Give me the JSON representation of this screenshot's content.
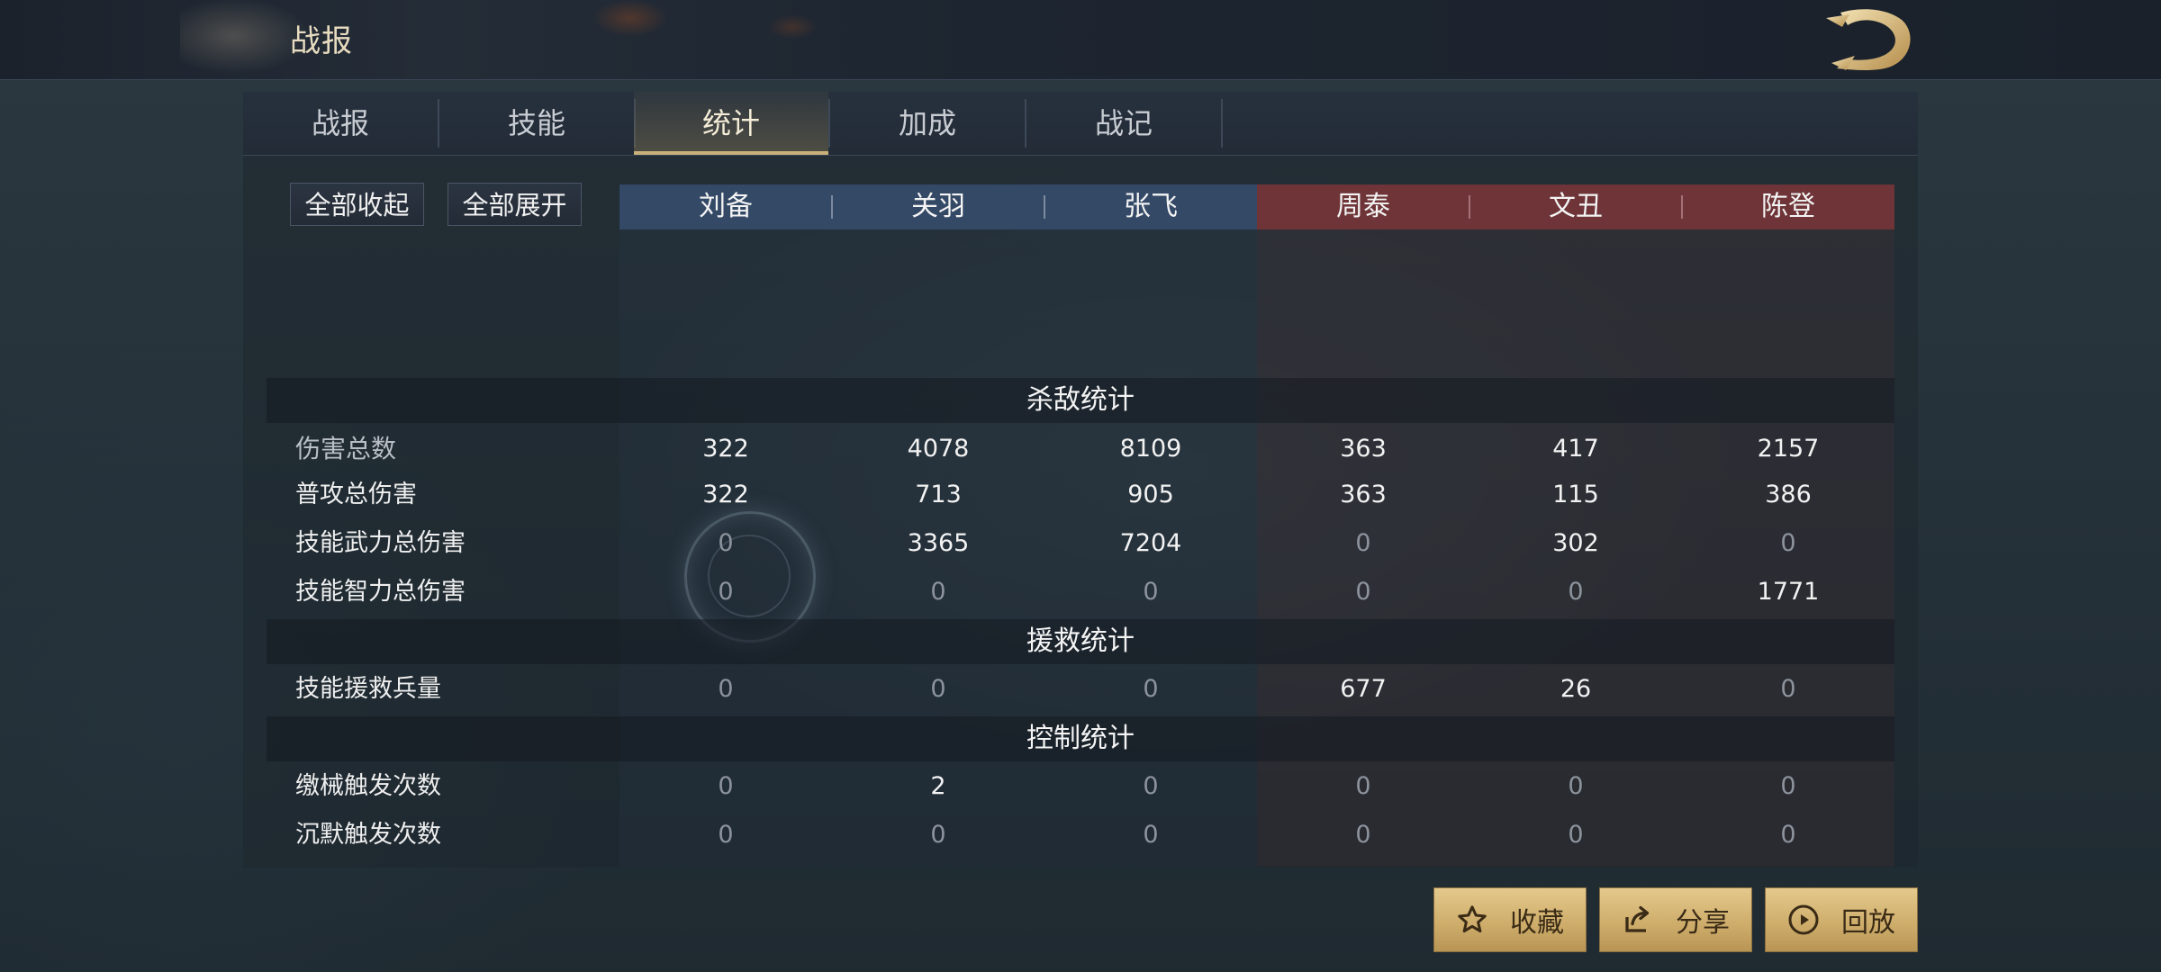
{
  "header": {
    "title": "战报"
  },
  "tabs": [
    {
      "label": "战报",
      "active": false
    },
    {
      "label": "技能",
      "active": false
    },
    {
      "label": "统计",
      "active": true
    },
    {
      "label": "加成",
      "active": false
    },
    {
      "label": "战记",
      "active": false
    }
  ],
  "controls": {
    "collapse_all": "全部收起",
    "expand_all": "全部展开"
  },
  "team_colors": {
    "ally": "#344966",
    "enemy": "#6e3438",
    "accent": "#c8b07a"
  },
  "heroes": {
    "ally": [
      "刘备",
      "关羽",
      "张飞"
    ],
    "enemy": [
      "周泰",
      "文丑",
      "陈登"
    ]
  },
  "sections": {
    "kill": {
      "title": "杀敌统计",
      "rows": [
        {
          "label": "伤害总数",
          "values": [
            "322",
            "4078",
            "8109",
            "363",
            "417",
            "2157"
          ]
        },
        {
          "label": "普攻总伤害",
          "values": [
            "322",
            "713",
            "905",
            "363",
            "115",
            "386"
          ]
        },
        {
          "label": "技能武力总伤害",
          "values": [
            "0",
            "3365",
            "7204",
            "0",
            "302",
            "0"
          ]
        },
        {
          "label": "技能智力总伤害",
          "values": [
            "0",
            "0",
            "0",
            "0",
            "0",
            "1771"
          ]
        }
      ]
    },
    "rescue": {
      "title": "援救统计",
      "rows": [
        {
          "label": "技能援救兵量",
          "values": [
            "0",
            "0",
            "0",
            "677",
            "26",
            "0"
          ]
        }
      ]
    },
    "control": {
      "title": "控制统计",
      "rows": [
        {
          "label": "缴械触发次数",
          "values": [
            "0",
            "2",
            "0",
            "0",
            "0",
            "0"
          ]
        },
        {
          "label": "沉默触发次数",
          "values": [
            "0",
            "0",
            "0",
            "0",
            "0",
            "0"
          ]
        }
      ]
    }
  },
  "actions": {
    "favorite": "收藏",
    "share": "分享",
    "replay": "回放"
  }
}
